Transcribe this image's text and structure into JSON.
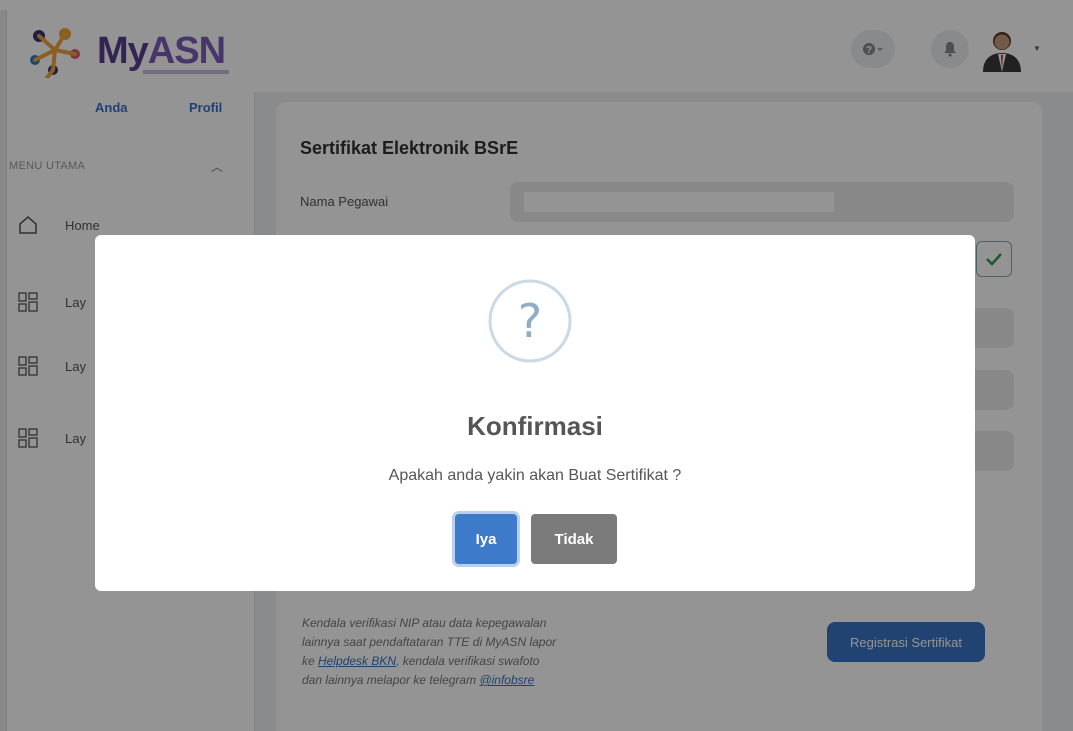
{
  "header": {
    "logo_text_my": "My",
    "logo_text_asn": "ASN",
    "help_icon": "question-circle-icon",
    "bell_icon": "bell-icon"
  },
  "sidebar": {
    "tab_anda": "Anda",
    "tab_profil": "Profil",
    "menu_title": "MENU UTAMA",
    "items": [
      {
        "label": "Home",
        "icon": "home-icon"
      },
      {
        "label": "Lay",
        "icon": "grid-icon"
      },
      {
        "label": "Lay",
        "icon": "grid-icon"
      },
      {
        "label": "Lay",
        "icon": "grid-icon"
      }
    ]
  },
  "main": {
    "title": "Sertifikat Elektronik BSrE",
    "field_label": "Nama Pegawai",
    "note_line1": "Kendala verifikasi NIP atau data kepegawalan",
    "note_line2": "lainnya saat pendaftataran TTE di MyASN lapor",
    "note_pre_link": "ke ",
    "note_link1": "Helpdesk BKN",
    "note_mid": ", kendala verifikasi swafoto",
    "note_line4": "dan lainnya melapor ke telegram ",
    "note_link2": "@infobsre",
    "register_button": "Registrasi Sertifikat"
  },
  "modal": {
    "title": "Konfirmasi",
    "message": "Apakah anda yakin akan Buat Sertifikat ?",
    "confirm_label": "Iya",
    "cancel_label": "Tidak",
    "icon_glyph": "?"
  },
  "colors": {
    "primary": "#3d7ac9",
    "secondary_button": "#7b7b7b",
    "question_icon": "#9fb9cf"
  }
}
